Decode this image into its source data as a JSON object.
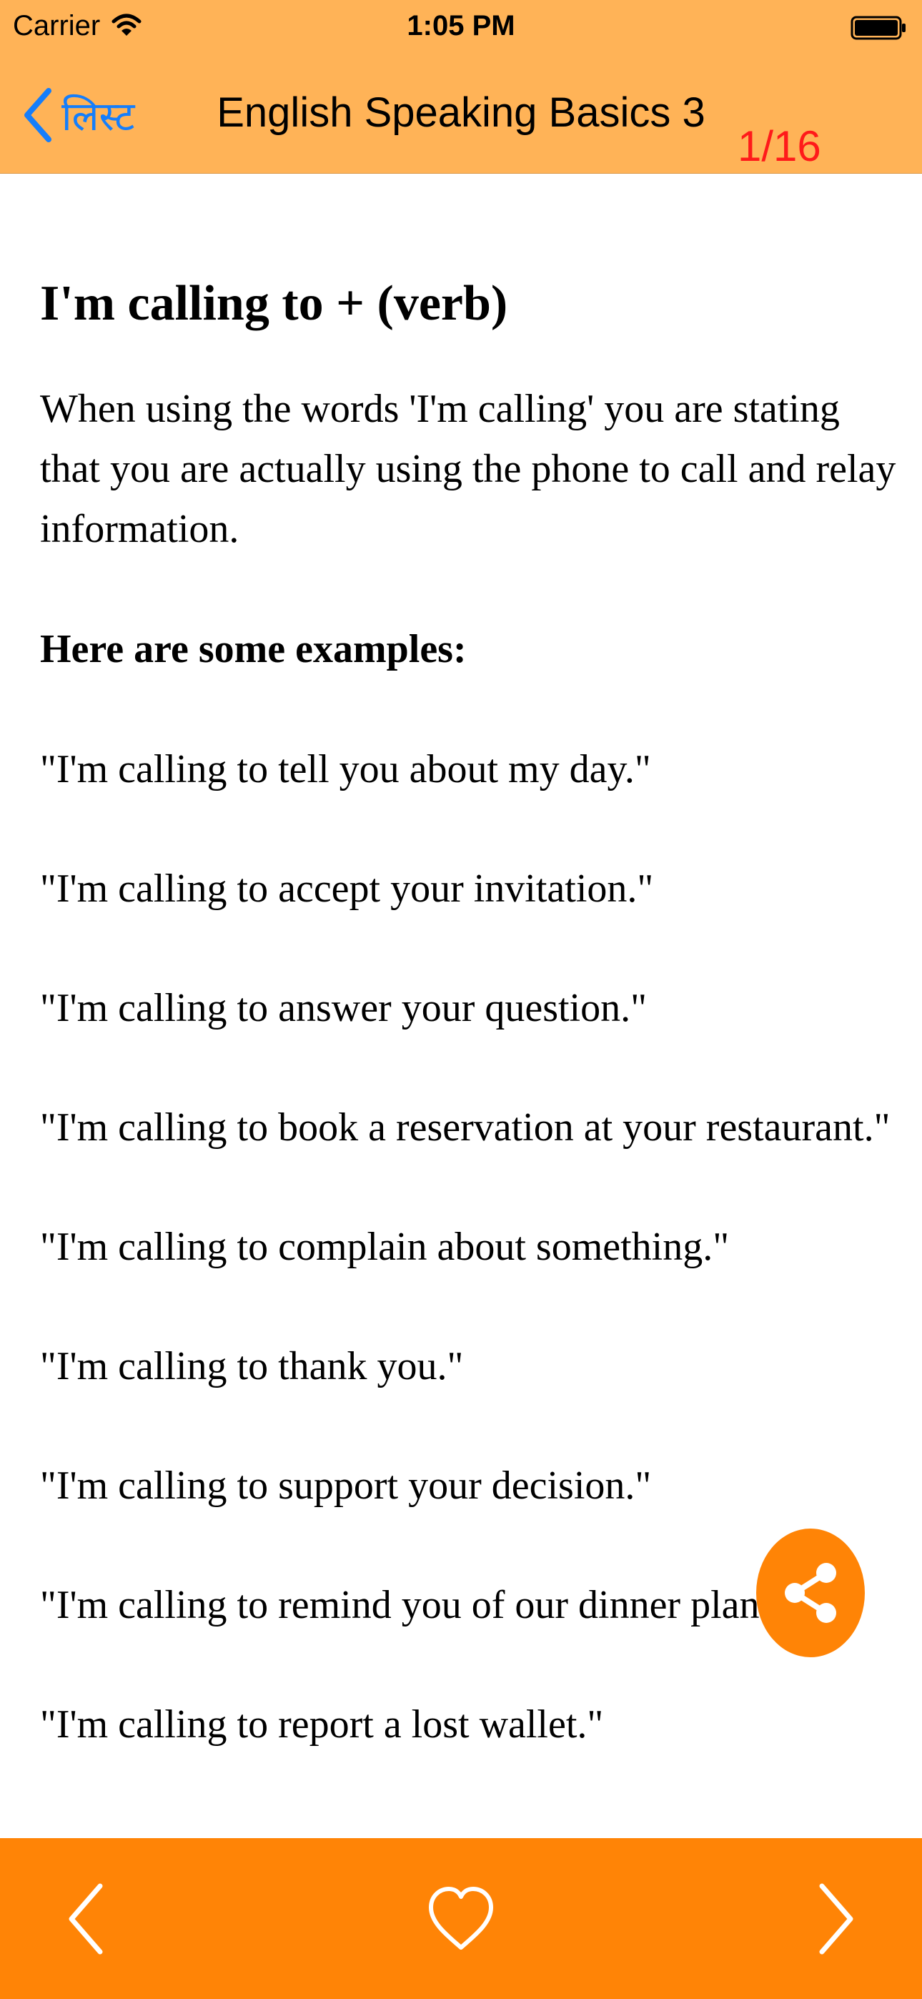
{
  "status_bar": {
    "carrier": "Carrier",
    "time": "1:05 PM"
  },
  "nav": {
    "back_label": "लिस्ट",
    "title": "English Speaking Basics 3",
    "page_counter": "1/16"
  },
  "lesson": {
    "heading": "I'm calling to + (verb)",
    "intro": "When using the words 'I'm calling' you are stating that you are actually using the phone to call and relay information.",
    "examples_heading": "Here are some examples:",
    "examples": [
      "\"I'm calling to tell you about my day.\"",
      "\"I'm calling to accept your invitation.\"",
      "\"I'm calling to answer your question.\"",
      "\"I'm calling to book a reservation at your restaurant.\"",
      "\"I'm calling to complain about something.\"",
      "\"I'm calling to thank you.\"",
      "\"I'm calling to support your decision.\"",
      "\"I'm calling to remind you of our dinner plans.\"",
      "\"I'm calling to report a lost wallet.\""
    ]
  },
  "icons": {
    "back": "chevron-left-icon",
    "share": "share-icon",
    "prev": "chevron-left-icon",
    "favorite": "heart-outline-icon",
    "next": "chevron-right-icon"
  },
  "colors": {
    "nav_background": "#FFB357",
    "accent_orange": "#FF8406",
    "back_blue": "#157EFB",
    "counter_red": "#FF1A1A"
  }
}
